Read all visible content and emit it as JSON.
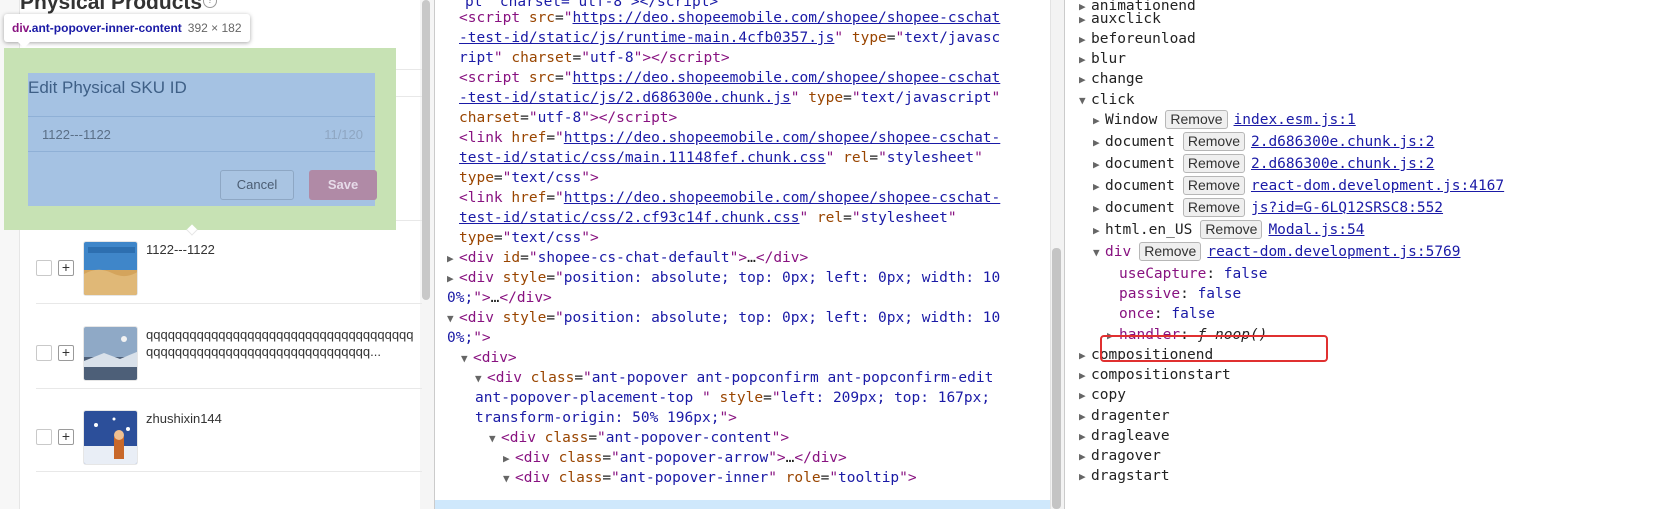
{
  "app": {
    "title": "Physical Products",
    "products": [
      {
        "name": "1122---1122"
      },
      {
        "name": "qqqqqqqqqqqqqqqqqqqqqqqqqqqqqqqqqqqqqqqqqqqqqqqqqqqqqqqqqqqqqqqqqqqq..."
      },
      {
        "name": "zhushixin144"
      }
    ]
  },
  "inspector_tooltip": {
    "tag": "div",
    "class": ".ant-popover-inner-content",
    "size": "392 × 182"
  },
  "popover": {
    "title": "Edit Physical SKU ID",
    "input_value": "1122---1122",
    "char_count": "11/120",
    "cancel_label": "Cancel",
    "save_label": "Save"
  },
  "elements": {
    "script1_src": "https://deo.shopeemobile.com/shopee/shopee-cschat-test-id/static/js/runtime-main.4cfb0357.js",
    "script2_src": "https://deo.shopeemobile.com/shopee/shopee-cschat-test-id/static/js/2.d686300e.chunk.js",
    "link1_href": "https://deo.shopeemobile.com/shopee/shopee-cschat-test-id/static/css/main.11148fef.chunk.css",
    "link2_href": "https://deo.shopeemobile.com/shopee/shopee-cschat-test-id/static/css/2.cf93c14f.chunk.css",
    "root_id": "shopee-cs-chat-default",
    "abs_style": "position: absolute; top: 0px; left: 0px; width: 100%;",
    "popover_class": "ant-popover ant-popconfirm ant-popconfirm-edit ant-popover-placement-top ",
    "popover_style": "left: 209px; top: 167px; transform-origin: 50% 196px;"
  },
  "listeners": {
    "events_before": [
      "auxclick",
      "beforeunload",
      "blur",
      "change"
    ],
    "expanded_event": "click",
    "entries": [
      {
        "target": "Window",
        "remove": "Remove",
        "source": "index.esm.js:1"
      },
      {
        "target": "document",
        "remove": "Remove",
        "source": "2.d686300e.chunk.js:2"
      },
      {
        "target": "document",
        "remove": "Remove",
        "source": "2.d686300e.chunk.js:2"
      },
      {
        "target": "document",
        "remove": "Remove",
        "source": "react-dom.development.js:4167"
      },
      {
        "target": "document",
        "remove": "Remove",
        "source": "js?id=G-6LQ12SRSC8:552"
      },
      {
        "target": "html.en_US",
        "remove": "Remove",
        "source": "Modal.js:54"
      },
      {
        "target": "div",
        "remove": "Remove",
        "source": "react-dom.development.js:5769"
      }
    ],
    "props": [
      {
        "key": "useCapture",
        "value": "false"
      },
      {
        "key": "passive",
        "value": "false"
      },
      {
        "key": "once",
        "value": "false"
      }
    ],
    "handler_key": "handler",
    "handler_value": "ƒ noop()",
    "events_after": [
      "compositionend",
      "compositionstart",
      "copy",
      "dragenter",
      "dragleave",
      "dragover",
      "dragstart"
    ]
  }
}
